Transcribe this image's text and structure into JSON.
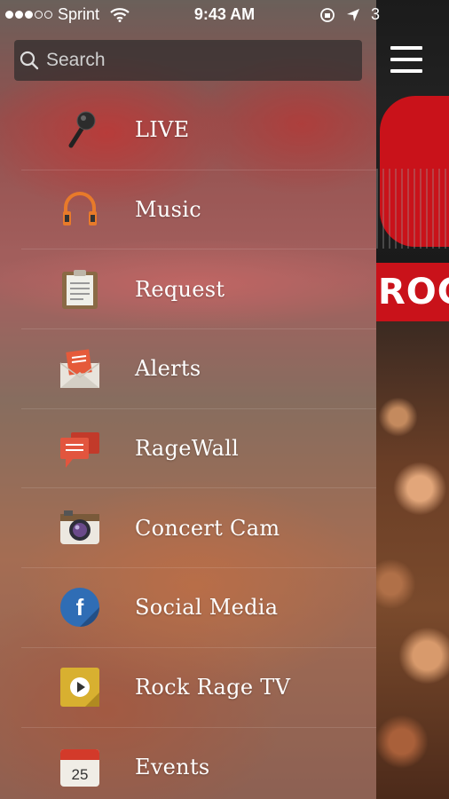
{
  "status_bar": {
    "carrier": "Sprint",
    "signal_bars_filled": 3,
    "signal_bars_total": 5,
    "time": "9:43 AM",
    "battery_partial_text": "3"
  },
  "search": {
    "placeholder": "Search"
  },
  "menu": [
    {
      "label": "LIVE",
      "icon": "microphone-icon"
    },
    {
      "label": "Music",
      "icon": "headphones-icon"
    },
    {
      "label": "Request",
      "icon": "clipboard-icon"
    },
    {
      "label": "Alerts",
      "icon": "envelope-alert-icon"
    },
    {
      "label": "RageWall",
      "icon": "chat-bubbles-icon"
    },
    {
      "label": "Concert Cam",
      "icon": "camera-icon"
    },
    {
      "label": "Social Media",
      "icon": "facebook-icon"
    },
    {
      "label": "Rock Rage TV",
      "icon": "play-video-icon"
    },
    {
      "label": "Events",
      "icon": "calendar-icon",
      "icon_text": "25"
    }
  ],
  "main": {
    "banner_text": "ROC"
  },
  "colors": {
    "brand_red": "#c9121a",
    "accent_orange": "#e87a2a"
  }
}
